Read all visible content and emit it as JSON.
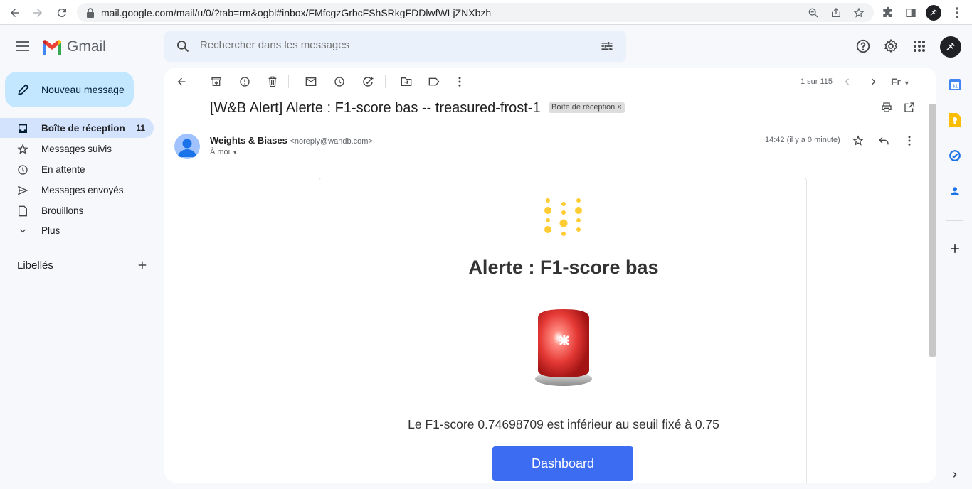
{
  "browser": {
    "url": "mail.google.com/mail/u/0/?tab=rm&ogbl#inbox/FMfcgzGrbcFShSRkgFDDlwfWLjZNXbzh"
  },
  "header": {
    "app_name": "Gmail",
    "search_placeholder": "Rechercher dans les messages"
  },
  "sidebar": {
    "compose_label": "Nouveau message",
    "items": [
      {
        "label": "Boîte de réception",
        "count": "11",
        "icon": "inbox-icon"
      },
      {
        "label": "Messages suivis",
        "icon": "star-icon"
      },
      {
        "label": "En attente",
        "icon": "clock-icon"
      },
      {
        "label": "Messages envoyés",
        "icon": "send-icon"
      },
      {
        "label": "Brouillons",
        "icon": "draft-icon"
      },
      {
        "label": "Plus",
        "icon": "chevron-down-icon"
      }
    ],
    "labels_title": "Libellés"
  },
  "toolbar": {
    "pager": "1 sur 115",
    "lang": "Fr"
  },
  "email": {
    "subject": "[W&B Alert] Alerte : F1-score bas -- treasured-frost-1",
    "chip": "Boîte de réception",
    "chip_close": "×",
    "sender_name": "Weights & Biases",
    "sender_email": "<noreply@wandb.com>",
    "to": "À moi",
    "time": "14:42 (il y a 0 minute)"
  },
  "body": {
    "title": "Alerte : F1-score bas",
    "message": "Le F1-score 0.74698709 est inférieur au seuil fixé à 0.75",
    "button": "Dashboard"
  },
  "colors": {
    "accent": "#3b6cf2",
    "compose_bg": "#c2e7ff",
    "active_nav": "#d3e3fd",
    "wandb_yellow": "#FFCC33"
  }
}
